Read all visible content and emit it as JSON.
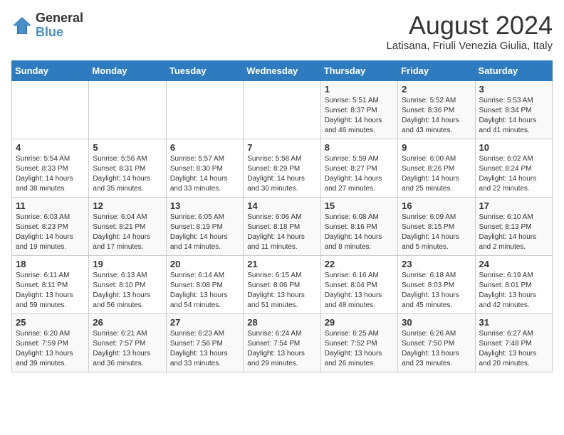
{
  "logo": {
    "text1": "General",
    "text2": "Blue"
  },
  "header": {
    "month_year": "August 2024",
    "location": "Latisana, Friuli Venezia Giulia, Italy"
  },
  "days_of_week": [
    "Sunday",
    "Monday",
    "Tuesday",
    "Wednesday",
    "Thursday",
    "Friday",
    "Saturday"
  ],
  "weeks": [
    [
      {
        "day": "",
        "info": ""
      },
      {
        "day": "",
        "info": ""
      },
      {
        "day": "",
        "info": ""
      },
      {
        "day": "",
        "info": ""
      },
      {
        "day": "1",
        "info": "Sunrise: 5:51 AM\nSunset: 8:37 PM\nDaylight: 14 hours and 46 minutes."
      },
      {
        "day": "2",
        "info": "Sunrise: 5:52 AM\nSunset: 8:36 PM\nDaylight: 14 hours and 43 minutes."
      },
      {
        "day": "3",
        "info": "Sunrise: 5:53 AM\nSunset: 8:34 PM\nDaylight: 14 hours and 41 minutes."
      }
    ],
    [
      {
        "day": "4",
        "info": "Sunrise: 5:54 AM\nSunset: 8:33 PM\nDaylight: 14 hours and 38 minutes."
      },
      {
        "day": "5",
        "info": "Sunrise: 5:56 AM\nSunset: 8:31 PM\nDaylight: 14 hours and 35 minutes."
      },
      {
        "day": "6",
        "info": "Sunrise: 5:57 AM\nSunset: 8:30 PM\nDaylight: 14 hours and 33 minutes."
      },
      {
        "day": "7",
        "info": "Sunrise: 5:58 AM\nSunset: 8:29 PM\nDaylight: 14 hours and 30 minutes."
      },
      {
        "day": "8",
        "info": "Sunrise: 5:59 AM\nSunset: 8:27 PM\nDaylight: 14 hours and 27 minutes."
      },
      {
        "day": "9",
        "info": "Sunrise: 6:00 AM\nSunset: 8:26 PM\nDaylight: 14 hours and 25 minutes."
      },
      {
        "day": "10",
        "info": "Sunrise: 6:02 AM\nSunset: 8:24 PM\nDaylight: 14 hours and 22 minutes."
      }
    ],
    [
      {
        "day": "11",
        "info": "Sunrise: 6:03 AM\nSunset: 8:23 PM\nDaylight: 14 hours and 19 minutes."
      },
      {
        "day": "12",
        "info": "Sunrise: 6:04 AM\nSunset: 8:21 PM\nDaylight: 14 hours and 17 minutes."
      },
      {
        "day": "13",
        "info": "Sunrise: 6:05 AM\nSunset: 8:19 PM\nDaylight: 14 hours and 14 minutes."
      },
      {
        "day": "14",
        "info": "Sunrise: 6:06 AM\nSunset: 8:18 PM\nDaylight: 14 hours and 11 minutes."
      },
      {
        "day": "15",
        "info": "Sunrise: 6:08 AM\nSunset: 8:16 PM\nDaylight: 14 hours and 8 minutes."
      },
      {
        "day": "16",
        "info": "Sunrise: 6:09 AM\nSunset: 8:15 PM\nDaylight: 14 hours and 5 minutes."
      },
      {
        "day": "17",
        "info": "Sunrise: 6:10 AM\nSunset: 8:13 PM\nDaylight: 14 hours and 2 minutes."
      }
    ],
    [
      {
        "day": "18",
        "info": "Sunrise: 6:11 AM\nSunset: 8:11 PM\nDaylight: 13 hours and 59 minutes."
      },
      {
        "day": "19",
        "info": "Sunrise: 6:13 AM\nSunset: 8:10 PM\nDaylight: 13 hours and 56 minutes."
      },
      {
        "day": "20",
        "info": "Sunrise: 6:14 AM\nSunset: 8:08 PM\nDaylight: 13 hours and 54 minutes."
      },
      {
        "day": "21",
        "info": "Sunrise: 6:15 AM\nSunset: 8:06 PM\nDaylight: 13 hours and 51 minutes."
      },
      {
        "day": "22",
        "info": "Sunrise: 6:16 AM\nSunset: 8:04 PM\nDaylight: 13 hours and 48 minutes."
      },
      {
        "day": "23",
        "info": "Sunrise: 6:18 AM\nSunset: 8:03 PM\nDaylight: 13 hours and 45 minutes."
      },
      {
        "day": "24",
        "info": "Sunrise: 6:19 AM\nSunset: 8:01 PM\nDaylight: 13 hours and 42 minutes."
      }
    ],
    [
      {
        "day": "25",
        "info": "Sunrise: 6:20 AM\nSunset: 7:59 PM\nDaylight: 13 hours and 39 minutes."
      },
      {
        "day": "26",
        "info": "Sunrise: 6:21 AM\nSunset: 7:57 PM\nDaylight: 13 hours and 36 minutes."
      },
      {
        "day": "27",
        "info": "Sunrise: 6:23 AM\nSunset: 7:56 PM\nDaylight: 13 hours and 33 minutes."
      },
      {
        "day": "28",
        "info": "Sunrise: 6:24 AM\nSunset: 7:54 PM\nDaylight: 13 hours and 29 minutes."
      },
      {
        "day": "29",
        "info": "Sunrise: 6:25 AM\nSunset: 7:52 PM\nDaylight: 13 hours and 26 minutes."
      },
      {
        "day": "30",
        "info": "Sunrise: 6:26 AM\nSunset: 7:50 PM\nDaylight: 13 hours and 23 minutes."
      },
      {
        "day": "31",
        "info": "Sunrise: 6:27 AM\nSunset: 7:48 PM\nDaylight: 13 hours and 20 minutes."
      }
    ]
  ]
}
